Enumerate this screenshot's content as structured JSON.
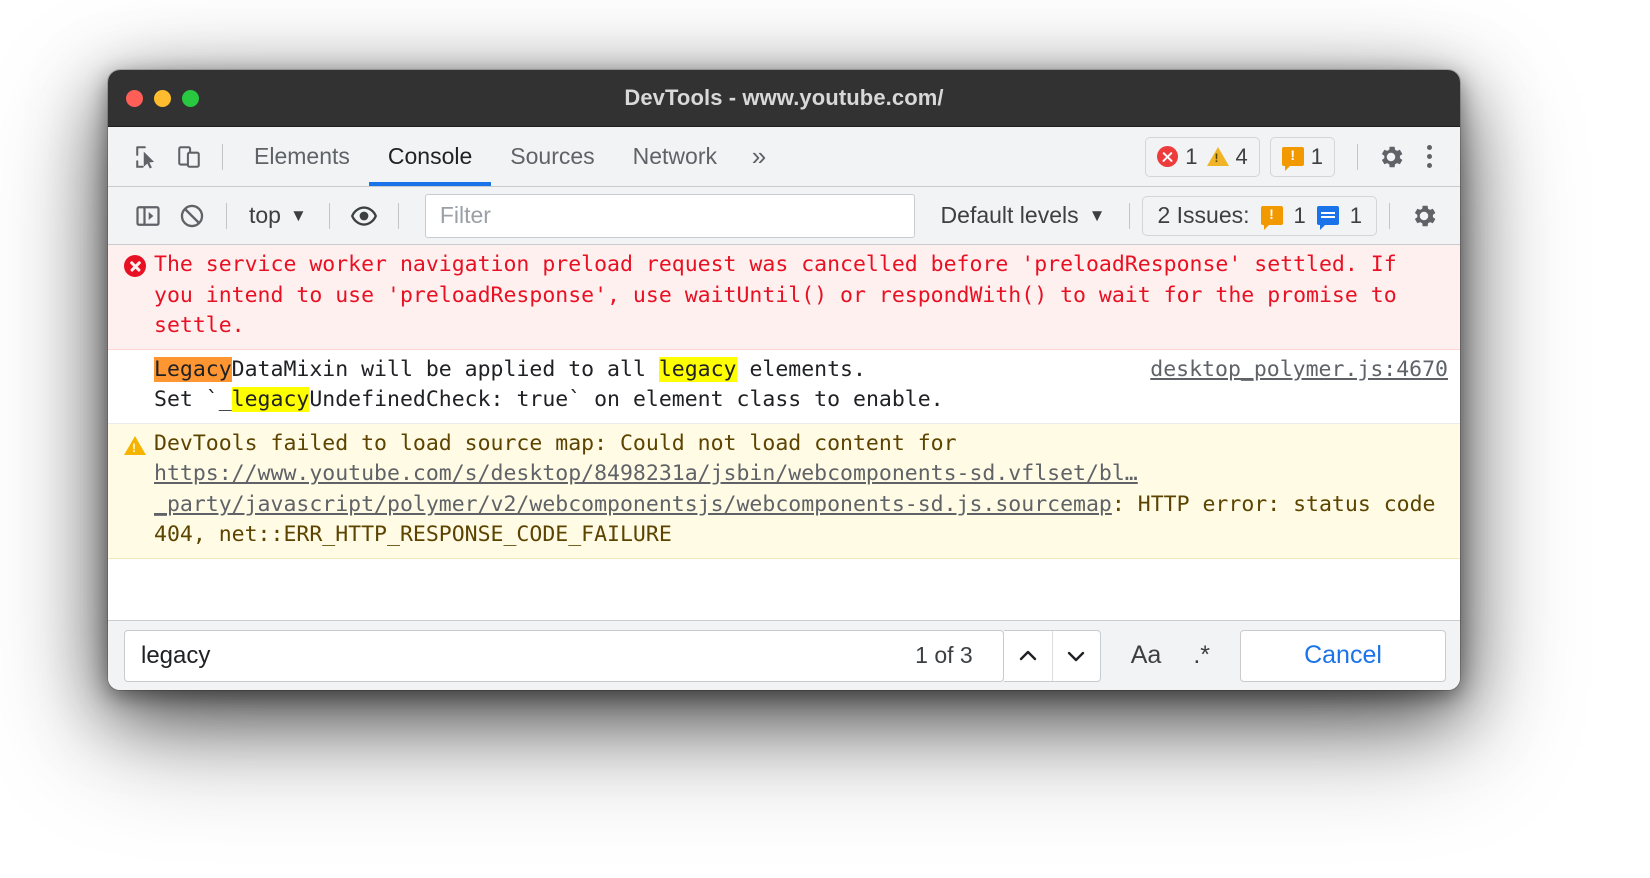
{
  "window": {
    "title": "DevTools - www.youtube.com/",
    "traffic_lights": [
      "close",
      "minimize",
      "maximize"
    ]
  },
  "tabbar": {
    "inspect_icon": "inspect-cursor-icon",
    "device_icon": "device-toolbar-icon",
    "tabs": [
      {
        "label": "Elements",
        "active": false
      },
      {
        "label": "Console",
        "active": true
      },
      {
        "label": "Sources",
        "active": false
      },
      {
        "label": "Network",
        "active": false
      }
    ],
    "more_tabs": "»",
    "error_count": "1",
    "warning_count": "4",
    "issue_count": "1",
    "settings_icon": "gear-icon",
    "more_icon": "kebab-menu-icon"
  },
  "console_toolbar": {
    "sidebar_icon": "console-sidebar-icon",
    "clear_icon": "clear-console-icon",
    "context": "top",
    "context_caret": "▼",
    "eye_icon": "live-expression-eye-icon",
    "filter_placeholder": "Filter",
    "filter_value": "",
    "levels_label": "Default levels",
    "levels_caret": "▼",
    "issues_label": "2 Issues:",
    "issues_warning_count": "1",
    "issues_info_count": "1",
    "settings_icon": "gear-icon"
  },
  "console_messages": [
    {
      "type": "error",
      "icon": "error-circle-icon",
      "text": "The service worker navigation preload request was cancelled before 'preloadResponse' settled. If you intend to use 'preloadResponse', use waitUntil() or respondWith() to wait for the promise to settle.",
      "source": ""
    },
    {
      "type": "plain",
      "icon": "",
      "segments": [
        {
          "text": "Legacy",
          "highlight": "active"
        },
        {
          "text": "DataMixin will be applied to all ",
          "highlight": "none"
        },
        {
          "text": "legacy",
          "highlight": "match"
        },
        {
          "text": " elements.\nSet `_",
          "highlight": "none"
        },
        {
          "text": "legacy",
          "highlight": "match"
        },
        {
          "text": "UndefinedCheck: true` on element class to enable.",
          "highlight": "none"
        }
      ],
      "source": "desktop_polymer.js:4670"
    },
    {
      "type": "warning",
      "icon": "warning-triangle-icon",
      "prefix": "DevTools failed to load source map: Could not load content for ",
      "url": "https://www.youtube.com/s/desktop/8498231a/jsbin/webcomponents-sd.vflset/bl…_party/javascript/polymer/v2/webcomponentsjs/webcomponents-sd.js.sourcemap",
      "suffix": ": HTTP error: status code 404, net::ERR_HTTP_RESPONSE_CODE_FAILURE",
      "source": ""
    }
  ],
  "searchbar": {
    "query": "legacy",
    "match_count": "1 of 3",
    "prev_icon": "⌃",
    "next_icon": "⌄",
    "match_case_label": "Aa",
    "regex_label": ".*",
    "cancel_label": "Cancel"
  },
  "colors": {
    "accent": "#1a73e8",
    "error_bg": "#fff0f0",
    "error_text": "#e81123",
    "warning_bg": "#fffbe5",
    "warning_text": "#5c4400",
    "highlight_yellow": "#ffff00",
    "highlight_orange": "#ff9632",
    "titlebar": "#323232",
    "toolbar_bg": "#f1f3f4"
  }
}
